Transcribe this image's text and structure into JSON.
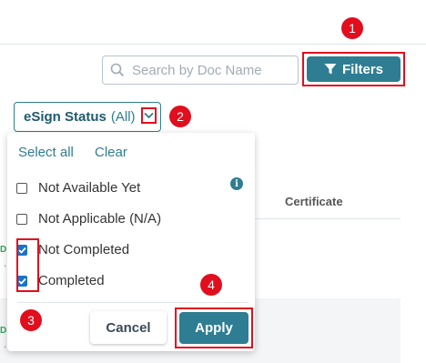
{
  "search": {
    "placeholder": "Search by Doc Name"
  },
  "toolbar": {
    "filters_label": "Filters"
  },
  "esign_filter": {
    "label": "eSign Status",
    "count": "(All)"
  },
  "dropdown": {
    "select_all": "Select all",
    "clear": "Clear",
    "options": [
      {
        "label": "Not Available Yet",
        "checked": false
      },
      {
        "label": "Not Applicable (N/A)",
        "checked": false
      },
      {
        "label": "Not Completed",
        "checked": true
      },
      {
        "label": "Completed",
        "checked": true
      }
    ],
    "info_icon": "i",
    "cancel_label": "Cancel",
    "apply_label": "Apply"
  },
  "table": {
    "certificate_header": "Certificate",
    "row_marks": [
      {
        "status": "D",
        "more": "..."
      },
      {
        "status": "D",
        "more": "..."
      }
    ]
  },
  "annotations": [
    "1",
    "2",
    "3",
    "4"
  ],
  "colors": {
    "accent": "#2e7d93",
    "annotation": "#e10e1e",
    "checkbox": "#1a73c7",
    "status_green": "#2fa75a"
  }
}
